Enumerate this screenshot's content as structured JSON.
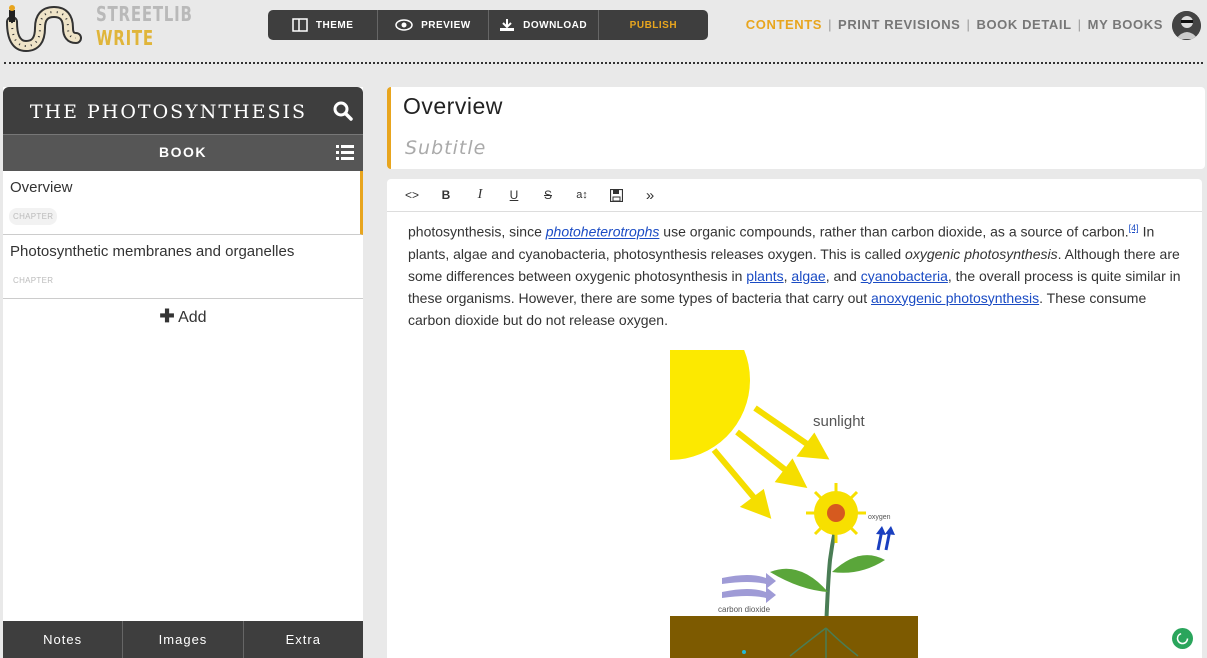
{
  "brand": {
    "line1": "STREETLIB",
    "line2": "WRITE"
  },
  "toolbar": {
    "theme": "THEME",
    "preview": "PREVIEW",
    "download": "DOWNLOAD",
    "publish": "PUBLISH"
  },
  "nav": {
    "contents": "CONTENTS",
    "print_revisions": "PRINT REVISIONS",
    "book_detail": "BOOK DETAIL",
    "my_books": "MY BOOKS"
  },
  "sidebar": {
    "book_title": "THE PHOTOSYNTHESIS",
    "section_label": "BOOK",
    "chapters": [
      {
        "title": "Overview",
        "badge": "CHAPTER"
      },
      {
        "title": "Photosynthetic membranes and organelles",
        "badge": "CHAPTER"
      }
    ],
    "add_label": "Add",
    "footer": {
      "notes": "Notes",
      "images": "Images",
      "extra": "Extra"
    }
  },
  "chapter": {
    "title": "Overview",
    "subtitle_placeholder": "Subtitle"
  },
  "editor": {
    "p1": "photosynthesis, since ",
    "link1": "photoheterotrophs",
    "p2": " use organic compounds, rather than carbon dioxide, as a source of carbon.",
    "ref": "[4]",
    "p3": " In plants, algae and cyanobacteria, photosynthesis releases oxygen. This is called ",
    "em1": "oxygenic photosynthesis",
    "p4": ". Although there are some differences between oxygenic photosynthesis in ",
    "link2": "plants",
    "p5": ", ",
    "link3": "algae",
    "p6": ", and ",
    "link4": "cyanobacteria",
    "p7": ", the overall process is quite similar in these organisms. However, there are some types of bacteria that carry out ",
    "link5": "anoxygenic photosynthesis",
    "p8": ". These consume carbon dioxide but do not release oxygen.",
    "diagram": {
      "sunlight": "sunlight",
      "oxygen": "oxygen",
      "co2": "carbon dioxide"
    }
  },
  "colors": {
    "accent": "#e8a51e",
    "dark": "#3e3e3e",
    "link": "#1a4bc4"
  }
}
